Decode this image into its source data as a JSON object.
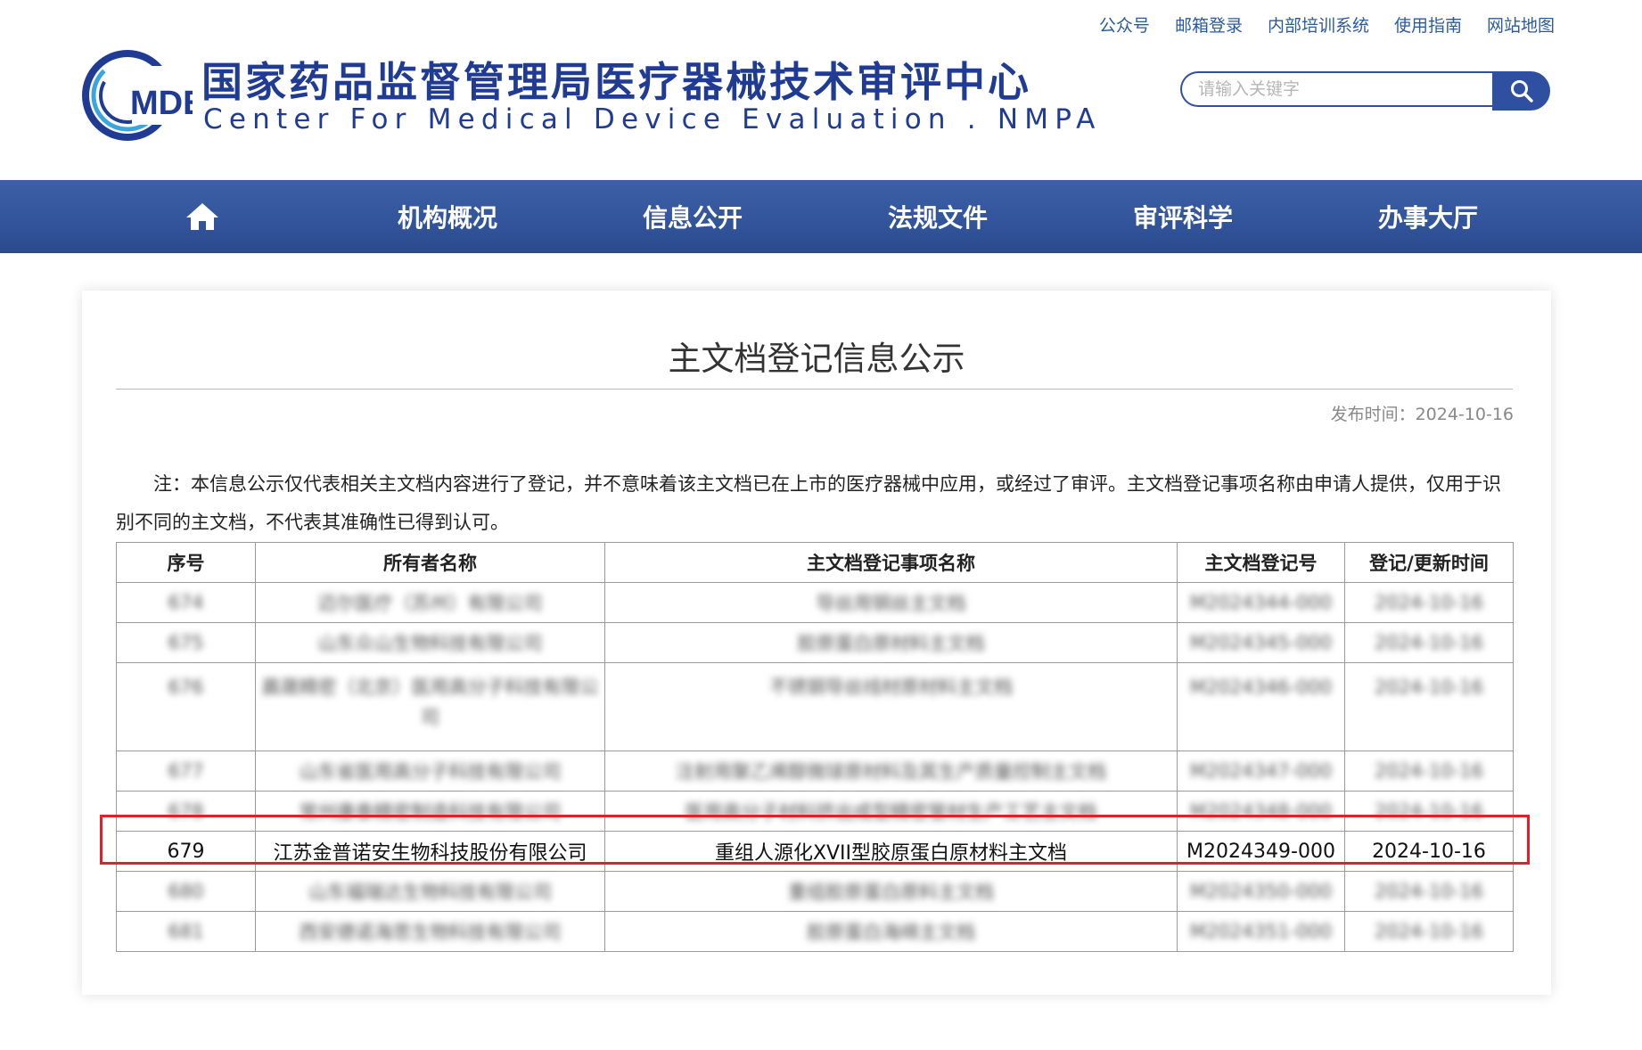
{
  "top_links": [
    "公众号",
    "邮箱登录",
    "内部培训系统",
    "使用指南",
    "网站地图"
  ],
  "logo": {
    "abbr": "MDE",
    "title_cn": "国家药品监督管理局医疗器械技术审评中心",
    "title_en": "Center For Medical Device Evaluation . NMPA"
  },
  "search": {
    "placeholder": "请输入关键字",
    "icon": "search-icon"
  },
  "nav": {
    "home_icon": "home-icon",
    "items": [
      "机构概况",
      "信息公开",
      "法规文件",
      "审评科学",
      "办事大厅"
    ]
  },
  "article": {
    "title": "主文档登记信息公示",
    "pub_date": "发布时间：2024-10-16",
    "note": "注：本信息公示仅代表相关主文档内容进行了登记，并不意味着该主文档已在上市的医疗器械中应用，或经过了审评。主文档登记事项名称由申请人提供，仅用于识别不同的主文档，不代表其准确性已得到认可。"
  },
  "table": {
    "headers": [
      "序号",
      "所有者名称",
      "主文档登记事项名称",
      "主文档登记号",
      "登记/更新时间"
    ],
    "rows": [
      {
        "no": "674",
        "owner": "迈尔医疗（苏州）有限公司",
        "item": "导丝用钢丝主文档",
        "reg": "M2024344-000",
        "date": "2024-10-16",
        "blurred": true
      },
      {
        "no": "675",
        "owner": "山东众山生物科技有限公司",
        "item": "胶原蛋白原材料主文档",
        "reg": "M2024345-000",
        "date": "2024-10-16",
        "blurred": true
      },
      {
        "no": "676",
        "owner": "晨晟精密（北京）医用高分子科技有限公司",
        "item": "不锈钢导丝线材原材料主文档",
        "reg": "M2024346-000",
        "date": "2024-10-16",
        "blurred": true,
        "tall": true
      },
      {
        "no": "677",
        "owner": "山东省医用高分子科技有限公司",
        "item": "注射用聚乙烯醇微球原材料及其生产质量控制主文档",
        "reg": "M2024347-000",
        "date": "2024-10-16",
        "blurred": true
      },
      {
        "no": "678",
        "owner": "常州康泰精密制造科技有限公司",
        "item": "医用高分子材料挤出成型精密管材生产工艺主文档",
        "reg": "M2024348-000",
        "date": "2024-10-16",
        "blurred": true
      },
      {
        "no": "679",
        "owner": "江苏金普诺安生物科技股份有限公司",
        "item": "重组人源化XVII型胶原蛋白原材料主文档",
        "reg": "M2024349-000",
        "date": "2024-10-16",
        "blurred": false
      },
      {
        "no": "680",
        "owner": "山东福瑞达生物科技有限公司",
        "item": "重组胶原蛋白原料主文档",
        "reg": "M2024350-000",
        "date": "2024-10-16",
        "blurred": true
      },
      {
        "no": "681",
        "owner": "西安德诺海思生物科技有限公司",
        "item": "胶原蛋白海绵主文档",
        "reg": "M2024351-000",
        "date": "2024-10-16",
        "blurred": true
      }
    ]
  },
  "colors": {
    "brand_blue": "#2f4fa0",
    "highlight_red": "#e0202a"
  }
}
